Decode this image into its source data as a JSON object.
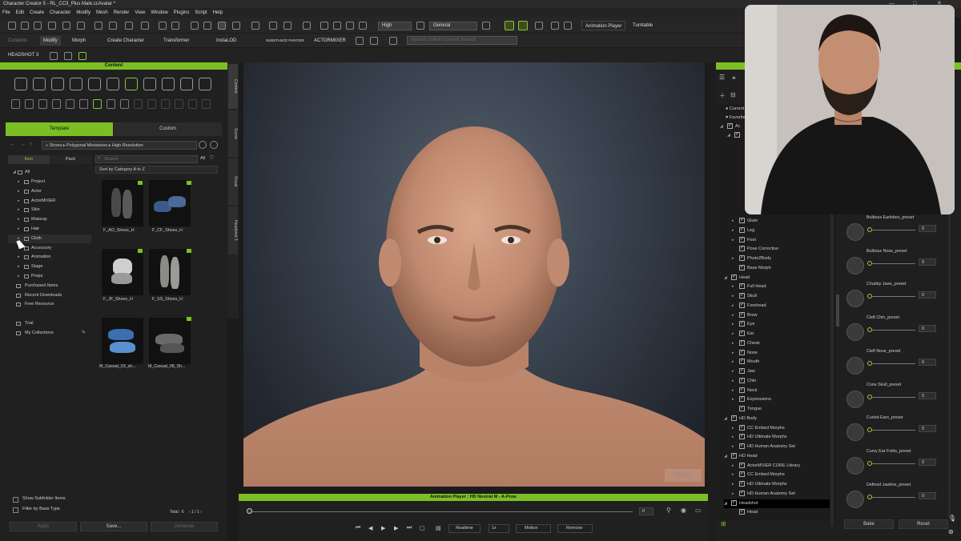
{
  "window": {
    "title": "Character Creator 5 - RL_CC3_Plus Male.ccAvatar *",
    "controls": [
      "—",
      "□",
      "✕"
    ]
  },
  "menu": [
    "File",
    "Edit",
    "Create",
    "Character",
    "Modify",
    "Mesh",
    "Render",
    "View",
    "Window",
    "Plugins",
    "Script",
    "Help"
  ],
  "toolbar": {
    "quality_select": "High",
    "mode_select": "General",
    "animation_player": "Animation Player",
    "turntable": "Turntable",
    "contents": "Contents",
    "modify": "Modify",
    "morph": "Morph",
    "create_character": "Create Character",
    "transformer": "Transformer",
    "instalod": "InstaLOD",
    "substance_painter": "SUBSTANCE PAINTER",
    "actormixer": "ACTORMIXER",
    "search_placeholder": "Search Online Content Search",
    "headshot": "HEADSHOT 3"
  },
  "content": {
    "header": "Content",
    "tab_template": "Template",
    "tab_custom": "Custom",
    "breadcrumb": "«   Shoes  ▸  Polygonal Miniatures  ▸  High Resolution",
    "sub_tab_item": "Item",
    "sub_tab_pack": "Pack",
    "search_placeholder": "Search",
    "filter_all": "All",
    "sort": "Sort by Category A to Z",
    "tree": [
      {
        "label": "All",
        "arrow": "◢"
      },
      {
        "label": "Project",
        "arrow": "▸"
      },
      {
        "label": "Actor",
        "arrow": "▸"
      },
      {
        "label": "ActorMIXER",
        "arrow": "▸"
      },
      {
        "label": "Skin",
        "arrow": "▸"
      },
      {
        "label": "Makeup",
        "arrow": "▸"
      },
      {
        "label": "Hair",
        "arrow": "▸"
      },
      {
        "label": "Cloth",
        "arrow": "▸"
      },
      {
        "label": "Accessory",
        "arrow": ""
      },
      {
        "label": "Animation",
        "arrow": "▸"
      },
      {
        "label": "Stage",
        "arrow": "▸"
      },
      {
        "label": "Props",
        "arrow": "▸"
      },
      {
        "label": "Purchased Items",
        "arrow": ""
      },
      {
        "label": "Recent Downloads",
        "arrow": ""
      },
      {
        "label": "Free Resource",
        "arrow": ""
      },
      {
        "label": "Trial",
        "arrow": ""
      },
      {
        "label": "My Collections",
        "arrow": ""
      }
    ],
    "items": [
      {
        "label": "F_AO_Shoes_H",
        "color": "#5a5a5a"
      },
      {
        "label": "F_CF_Shoes_H",
        "color": "#3d5a8a"
      },
      {
        "label": "F_JF_Shoes_H",
        "color": "#d0d0d0"
      },
      {
        "label": "F_SS_Shoes_H",
        "color": "#8a8a88"
      },
      {
        "label": "M_Casual_03_sh...",
        "color": "#3a6fb0"
      },
      {
        "label": "M_Casual_08_Sh...",
        "color": "#6a6a6a"
      }
    ],
    "show_subfolder": "Show Subfolder Items",
    "filter_base_type": "Filter by Base Type",
    "total": "Total : 6",
    "pagination": "‹   1  /  1   ›",
    "apply": "Apply",
    "save": "Save...",
    "generate": "Generate"
  },
  "side_tabs": [
    "Content",
    "Scene",
    "Visual",
    "Headshot 3"
  ],
  "viewport": {
    "watermark": "Nell 0"
  },
  "animation_player": {
    "title": "Animation Player : HD Neutral M - A-Pose",
    "frame": "0",
    "realtime": "Realtime",
    "speed": "1x",
    "motion": "Motion",
    "remove": "Remove"
  },
  "right_panel": {
    "top_items": [
      "Current",
      "Favorite"
    ],
    "tree": [
      {
        "label": "Glute",
        "indent": 2,
        "arrow": "▸"
      },
      {
        "label": "Leg",
        "indent": 2,
        "arrow": "▸"
      },
      {
        "label": "Foot",
        "indent": 2,
        "arrow": "▸"
      },
      {
        "label": "Pose Corrective",
        "indent": 2,
        "arrow": ""
      },
      {
        "label": "Photo2Body",
        "indent": 2,
        "arrow": "▸"
      },
      {
        "label": "Base Morph",
        "indent": 2,
        "arrow": ""
      },
      {
        "label": "Head",
        "indent": 1,
        "arrow": "◢"
      },
      {
        "label": "Full Head",
        "indent": 2,
        "arrow": "▸"
      },
      {
        "label": "Skull",
        "indent": 2,
        "arrow": "▸"
      },
      {
        "label": "Forehead",
        "indent": 2,
        "arrow": "▸"
      },
      {
        "label": "Brow",
        "indent": 2,
        "arrow": "▸"
      },
      {
        "label": "Eye",
        "indent": 2,
        "arrow": "▸"
      },
      {
        "label": "Ear",
        "indent": 2,
        "arrow": "▸"
      },
      {
        "label": "Cheek",
        "indent": 2,
        "arrow": "▸"
      },
      {
        "label": "Nose",
        "indent": 2,
        "arrow": "▸"
      },
      {
        "label": "Mouth",
        "indent": 2,
        "arrow": "▸"
      },
      {
        "label": "Jaw",
        "indent": 2,
        "arrow": "▸"
      },
      {
        "label": "Chin",
        "indent": 2,
        "arrow": "▸"
      },
      {
        "label": "Neck",
        "indent": 2,
        "arrow": "▸"
      },
      {
        "label": "Expressions",
        "indent": 2,
        "arrow": "▸"
      },
      {
        "label": "Tongue",
        "indent": 2,
        "arrow": ""
      },
      {
        "label": "HD Body",
        "indent": 1,
        "arrow": "◢"
      },
      {
        "label": "CC Embed Morphs",
        "indent": 2,
        "arrow": "▸"
      },
      {
        "label": "HD Ultimate Morphs",
        "indent": 2,
        "arrow": "▸"
      },
      {
        "label": "HD Human Anatomy Set",
        "indent": 2,
        "arrow": "▸"
      },
      {
        "label": "HD Head",
        "indent": 1,
        "arrow": "◢"
      },
      {
        "label": "ActorMIXER CORE Library",
        "indent": 2,
        "arrow": "▸"
      },
      {
        "label": "CC Embed Morphs",
        "indent": 2,
        "arrow": "▸"
      },
      {
        "label": "HD Ultimate Morphs",
        "indent": 2,
        "arrow": "▸"
      },
      {
        "label": "HD Human Anatomy Set",
        "indent": 2,
        "arrow": "▸"
      },
      {
        "label": "Headshot",
        "indent": 1,
        "arrow": "◢"
      },
      {
        "label": "Head",
        "indent": 2,
        "arrow": ""
      }
    ],
    "morphs": [
      {
        "name": "Bulbous Earlobes_preset",
        "value": "0"
      },
      {
        "name": "Bulbous Nose_preset",
        "value": "0"
      },
      {
        "name": "Chubby Jaws_preset",
        "value": "0"
      },
      {
        "name": "Cleft Chin_preset",
        "value": "0"
      },
      {
        "name": "Cleft Nose_preset",
        "value": "0"
      },
      {
        "name": "Cone Skull_preset",
        "value": "0"
      },
      {
        "name": "Curled Ears_preset",
        "value": "0"
      },
      {
        "name": "Curvy Ear Folds_preset",
        "value": "0"
      },
      {
        "name": "Defined Jawline_preset",
        "value": "0"
      }
    ],
    "bake": "Bake",
    "reset": "Reset"
  },
  "colors": {
    "accent": "#7cbf24",
    "panel": "#202020"
  }
}
